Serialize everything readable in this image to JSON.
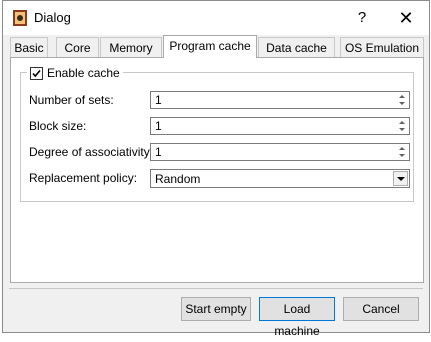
{
  "window": {
    "title": "Dialog",
    "help_glyph": "?",
    "close_glyph": "✕"
  },
  "tabs": [
    {
      "label": "Basic"
    },
    {
      "label": "Core"
    },
    {
      "label": "Memory"
    },
    {
      "label": "Program cache",
      "active": true
    },
    {
      "label": "Data cache"
    },
    {
      "label": "OS Emulation"
    }
  ],
  "cache": {
    "enable_label": "Enable cache",
    "enabled": true,
    "fields": [
      {
        "label": "Number of sets:",
        "value": "1"
      },
      {
        "label": "Block size:",
        "value": "1"
      },
      {
        "label": "Degree of associativity:",
        "value": "1"
      }
    ],
    "replacement": {
      "label": "Replacement policy:",
      "value": "Random"
    }
  },
  "buttons": {
    "start_empty": "Start empty",
    "load_machine": "Load machine",
    "cancel": "Cancel"
  },
  "colors": {
    "focus_border": "#0078d7",
    "panel_bg": "#ffffff",
    "dialog_bg": "#f0f0f0"
  }
}
